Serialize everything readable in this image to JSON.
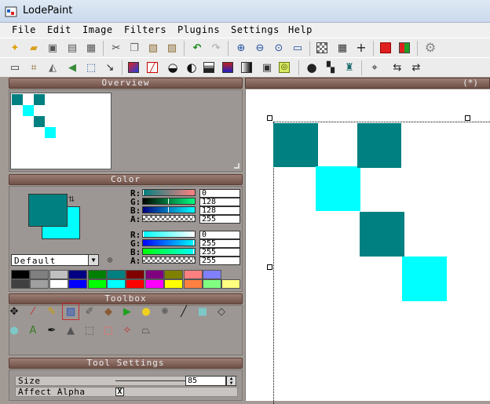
{
  "window": {
    "title": "LodePaint"
  },
  "menu": [
    "File",
    "Edit",
    "Image",
    "Filters",
    "Plugins",
    "Settings",
    "Help"
  ],
  "toolbar1_icons": [
    "new-file-icon",
    "open-folder-icon",
    "save-icon",
    "save-as-icon",
    "save-all-icon",
    "cut-icon",
    "copy-icon",
    "paste-icon",
    "paste-special-icon",
    "undo-icon",
    "redo-icon",
    "zoom-in-icon",
    "zoom-out-icon",
    "zoom-fit-icon",
    "fullscreen-icon",
    "checker-background-icon",
    "grid-icon",
    "crosshair-icon",
    "red-square-icon",
    "color-channels-icon",
    "settings-gear-icon"
  ],
  "toolbar2_icons": [
    "select-all-icon",
    "crop-icon",
    "flip-horizontal-icon",
    "flip-vertical-icon",
    "fit-selection-icon",
    "arrow-diagonal-icon",
    "color-adjust-icon",
    "no-color-icon",
    "contrast-icon",
    "invert-icon",
    "gradient-map-icon",
    "grayscale-icon",
    "alpha-icon",
    "alpha-mask-icon",
    "blur-icon",
    "pixelate-icon",
    "plugin-icon",
    "transform-icon",
    "rotate-left-icon",
    "rotate-right-icon"
  ],
  "panels": {
    "overview_title": "Overview",
    "color_title": "Color",
    "toolbox_title": "Toolbox",
    "tool_settings_title": "Tool Settings"
  },
  "canvas": {
    "tab_label": "(*)"
  },
  "color": {
    "primary_hex": "#008080",
    "secondary_hex": "#00ffff",
    "primary": [
      {
        "label": "R:",
        "value": "0"
      },
      {
        "label": "G:",
        "value": "128"
      },
      {
        "label": "B:",
        "value": "128"
      },
      {
        "label": "A:",
        "value": "255"
      }
    ],
    "secondary": [
      {
        "label": "R:",
        "value": "0"
      },
      {
        "label": "G:",
        "value": "255"
      },
      {
        "label": "B:",
        "value": "255"
      },
      {
        "label": "A:",
        "value": "255"
      }
    ],
    "palette_select": "Default",
    "palette_row1": [
      "#000000",
      "#808080",
      "#c0c0c0",
      "#000080",
      "#008000",
      "#008080",
      "#800000",
      "#800080",
      "#808000",
      "#ff8080",
      "#8080ff"
    ],
    "palette_row2": [
      "#404040",
      "#a0a0a0",
      "#ffffff",
      "#0000ff",
      "#00ff00",
      "#00ffff",
      "#ff0000",
      "#ff00ff",
      "#ffff00",
      "#ff8040",
      "#80ff80",
      "#ffff80"
    ]
  },
  "toolbox": {
    "row1": [
      "move-icon",
      "eyedropper-icon",
      "pencil-icon",
      "brush-icon",
      "color-picker-icon",
      "eraser-icon",
      "flag-icon",
      "lightbulb-icon",
      "spray-icon",
      "line-icon",
      "rectangle-icon",
      "lasso-icon"
    ],
    "row2": [
      "ellipse-icon",
      "text-icon",
      "pen-icon",
      "triangle-icon",
      "selection-rect-icon",
      "rounded-rect-icon",
      "magic-wand-icon",
      "polygon-icon"
    ]
  },
  "tool_settings": {
    "size_label": "Size",
    "size_value": "85",
    "size_fraction": 0.88,
    "affect_alpha_label": "Affect Alpha",
    "affect_alpha_checked": "X"
  },
  "canvas_pixels": {
    "dark": "#008080",
    "light": "#00ffff"
  }
}
